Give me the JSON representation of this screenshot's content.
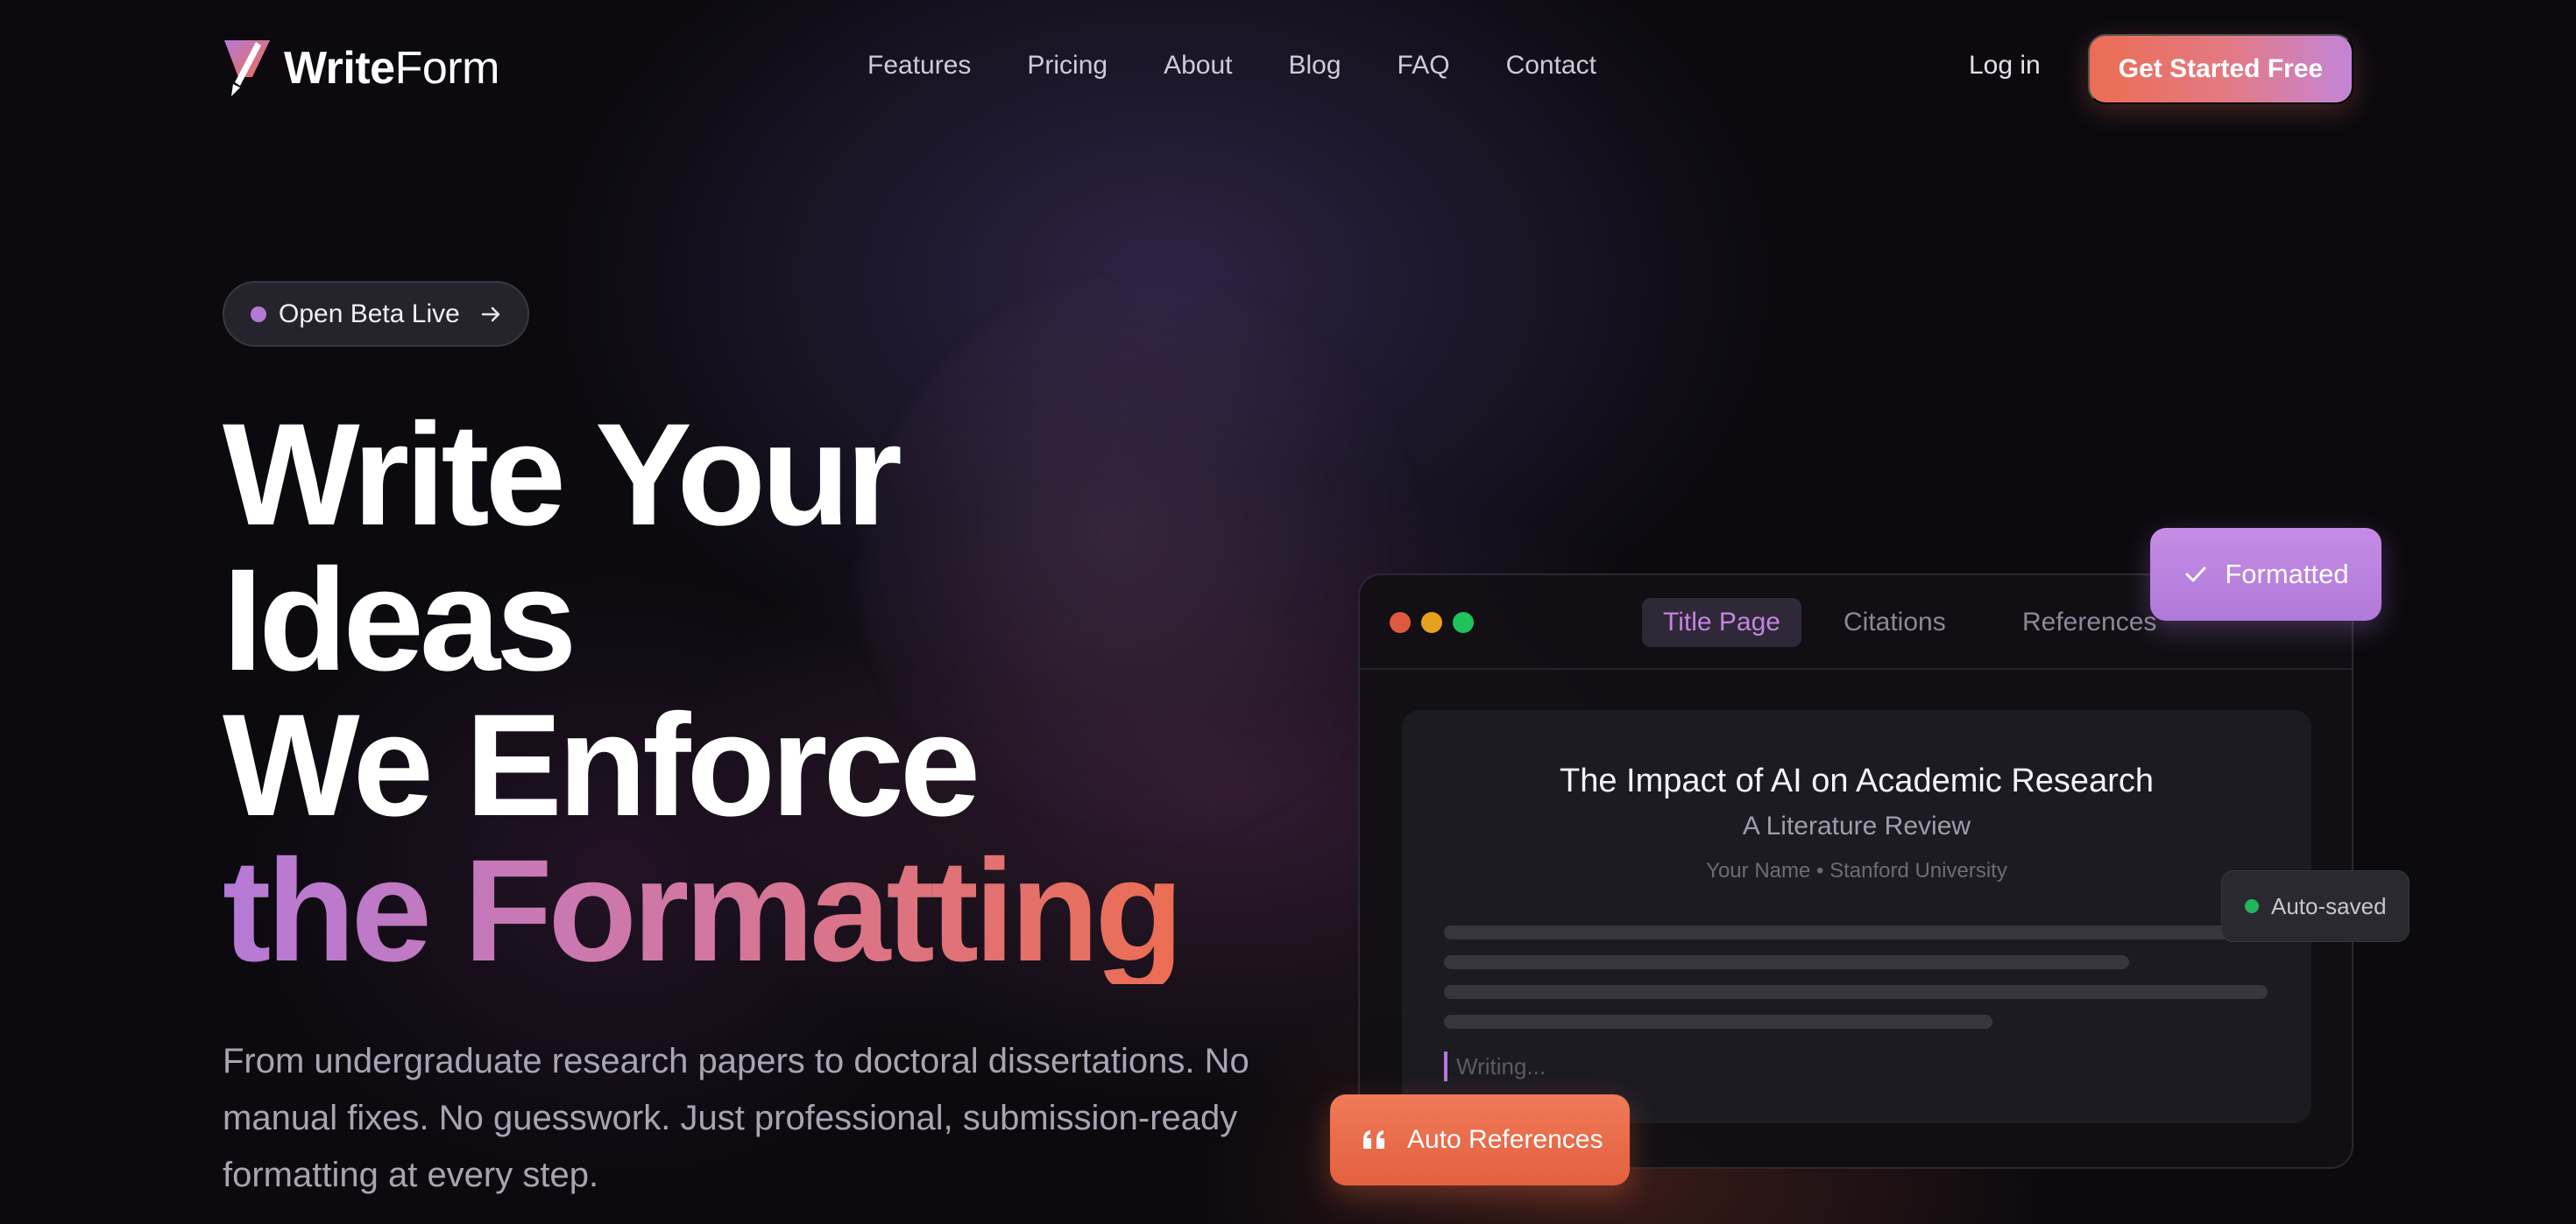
{
  "brand": {
    "name_bold": "Write",
    "name_light": "Form",
    "logo_icon": "quill-icon",
    "accent_orange": "#ec6d52",
    "accent_purple": "#b57ad8"
  },
  "nav": {
    "links": [
      "Features",
      "Pricing",
      "About",
      "Blog",
      "FAQ",
      "Contact"
    ],
    "login_label": "Log in",
    "cta_label": "Get Started Free"
  },
  "badge": {
    "label": "Open Beta Live",
    "icon": "arrow-right-icon"
  },
  "hero": {
    "line1": "Write Your",
    "line2": "Ideas",
    "line3": "We Enforce",
    "line4": "the Formatting",
    "subtitle": "From undergraduate research papers to doctoral dissertations. No manual fixes. No guesswork. Just professional, submission-ready formatting at every step."
  },
  "mockup": {
    "tabs": [
      "Title Page",
      "Citations",
      "References"
    ],
    "active_tab": "Title Page",
    "doc_title": "The Impact of AI on Academic Research",
    "doc_subtitle": "A Literature Review",
    "doc_author": "Your Name • Stanford University",
    "writing_placeholder": "Writing...",
    "formatted_label": "Formatted",
    "autosaved_label": "Auto-saved",
    "autoref_label": "Auto References"
  }
}
